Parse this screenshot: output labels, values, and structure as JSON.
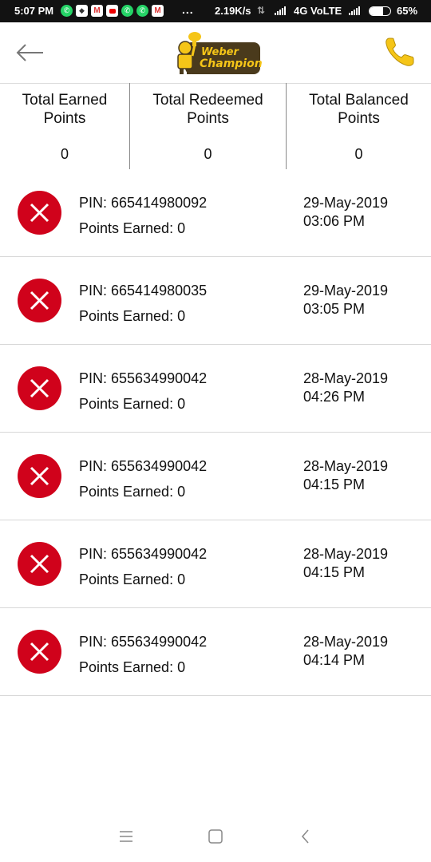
{
  "status_bar": {
    "time": "5:07 PM",
    "notification_icons": [
      "whatsapp-icon",
      "app-icon",
      "gmail-icon",
      "youtube-icon",
      "whatsapp-icon",
      "whatsapp-icon",
      "gmail-icon"
    ],
    "more_dots": "...",
    "net_speed": "2.19K/s",
    "network_type": "4G VoLTE",
    "battery_percent": "65%",
    "battery_level": 0.65
  },
  "app_bar": {
    "back_icon": "back-arrow-icon",
    "logo_line1": "Weber",
    "logo_line2": "Champion",
    "phone_icon": "phone-icon",
    "accent_color": "#f5c518"
  },
  "summary": [
    {
      "label": "Total Earned Points",
      "value": "0"
    },
    {
      "label": "Total Redeemed Points",
      "value": "0"
    },
    {
      "label": "Total Balanced Points",
      "value": "0"
    }
  ],
  "transactions": [
    {
      "pin": "PIN: 665414980092",
      "points": "Points Earned: 0",
      "date": "29-May-2019",
      "time": "03:06 PM",
      "status_icon": "rejected-x-icon"
    },
    {
      "pin": "PIN: 665414980035",
      "points": "Points Earned: 0",
      "date": "29-May-2019",
      "time": "03:05 PM",
      "status_icon": "rejected-x-icon"
    },
    {
      "pin": "PIN: 655634990042",
      "points": "Points Earned: 0",
      "date": "28-May-2019",
      "time": "04:26 PM",
      "status_icon": "rejected-x-icon"
    },
    {
      "pin": "PIN: 655634990042",
      "points": "Points Earned: 0",
      "date": "28-May-2019",
      "time": "04:15 PM",
      "status_icon": "rejected-x-icon"
    },
    {
      "pin": "PIN: 655634990042",
      "points": "Points Earned: 0",
      "date": "28-May-2019",
      "time": "04:15 PM",
      "status_icon": "rejected-x-icon"
    },
    {
      "pin": "PIN: 655634990042",
      "points": "Points Earned: 0",
      "date": "28-May-2019",
      "time": "04:14 PM",
      "status_icon": "rejected-x-icon"
    }
  ],
  "status_color": "#d0021b",
  "nav_bar": {
    "icons": [
      "menu-icon",
      "home-icon",
      "back-icon"
    ]
  }
}
